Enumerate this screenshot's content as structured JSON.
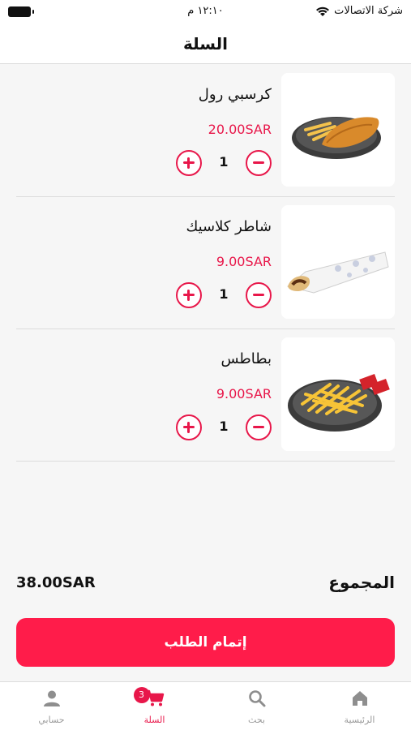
{
  "status_bar": {
    "carrier": "شركة الاتصالات",
    "time": "١٢:١٠ م"
  },
  "header": {
    "title": "السلة"
  },
  "cart": {
    "items": [
      {
        "name": "كرسبي رول",
        "price": "20.00SAR",
        "quantity": "1",
        "image_icon": "crispy-roll-plate"
      },
      {
        "name": "شاطر كلاسيك",
        "price": "9.00SAR",
        "quantity": "1",
        "image_icon": "wrap-sandwich"
      },
      {
        "name": "بطاطس",
        "price": "9.00SAR",
        "quantity": "1",
        "image_icon": "fries-plate"
      }
    ]
  },
  "summary": {
    "total_label": "المجموع",
    "total_value": "38.00SAR"
  },
  "checkout": {
    "label": "إتمام الطلب"
  },
  "tabbar": {
    "tabs": [
      {
        "label": "الرئيسية",
        "icon": "home-icon"
      },
      {
        "label": "بحث",
        "icon": "search-icon"
      },
      {
        "label": "السلة",
        "icon": "cart-icon",
        "badge": "3"
      },
      {
        "label": "حسابي",
        "icon": "user-icon"
      }
    ]
  },
  "colors": {
    "accent": "#e8174a",
    "button": "#ff1c4a",
    "background": "#f6f6f6"
  }
}
